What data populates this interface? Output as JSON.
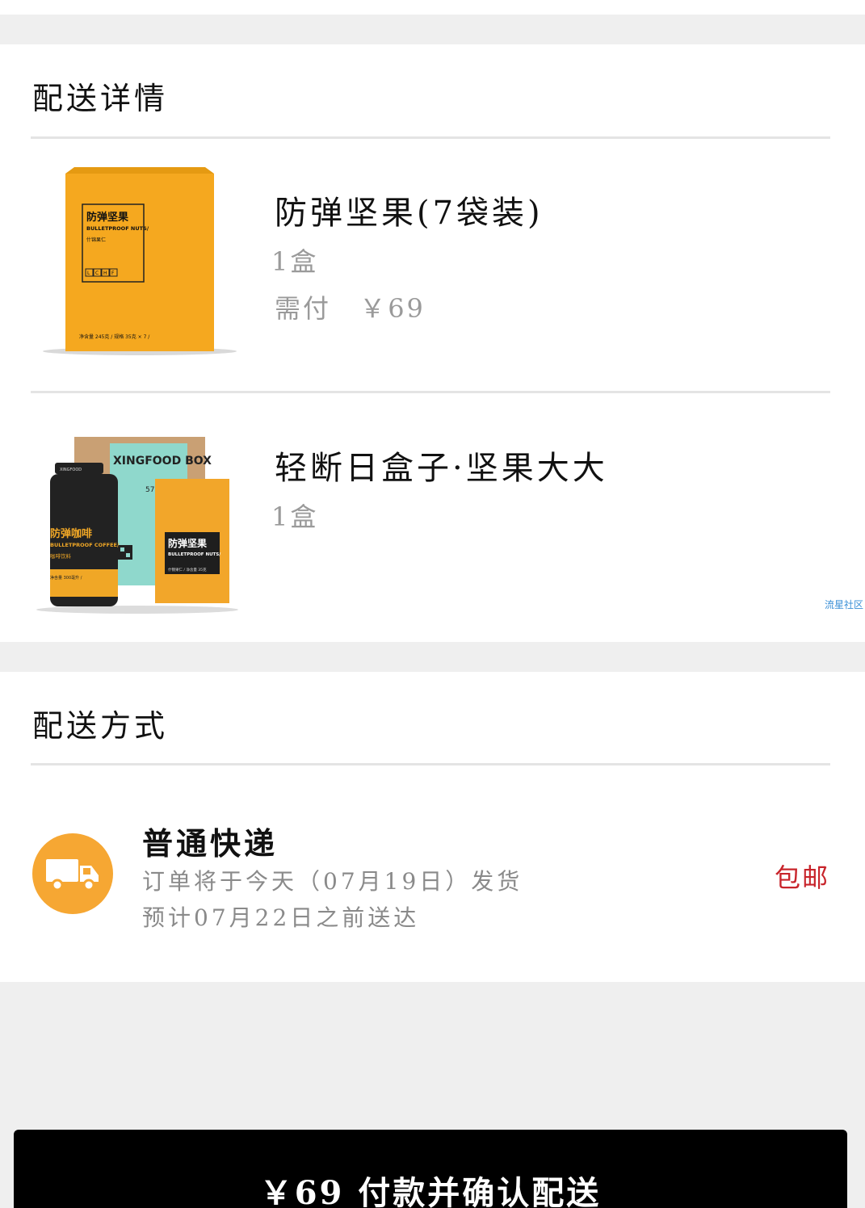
{
  "delivery_details": {
    "title": "配送详情",
    "items": [
      {
        "name": "防弹坚果(7袋装)",
        "quantity": "1盒",
        "price_label": "需付",
        "price": "￥69",
        "image_icon": "bulletproof-nuts-box",
        "image_text": {
          "brand": "防弹坚果",
          "english": "BULLETPROOF NUTS/",
          "sub": "什锦果仁",
          "tags": [
            "L",
            "C",
            "H",
            "F"
          ],
          "footer": "净含量 245克 /  规格 35克 × 7 /"
        }
      },
      {
        "name": "轻断日盒子·坚果大大",
        "quantity": "1盒",
        "image_icon": "xingfood-box-bundle",
        "image_text": {
          "box_title": "XINGFOOD BOX",
          "box_number": "575",
          "can_brand": "XINGFOOD",
          "can_name": "防弹咖啡",
          "can_english": "BULLETPROOF COFFEE/",
          "can_sub": "咖啡饮料",
          "can_volume": "净含量 300毫升 /",
          "bag_name": "防弹坚果",
          "bag_english": "BULLETPROOF NUTS/",
          "bag_sub": "什锦果仁 /  净含量 35克"
        }
      }
    ]
  },
  "watermark": "流星社区",
  "shipping": {
    "title": "配送方式",
    "icon": "truck-icon",
    "method": "普通快递",
    "ship_info": "订单将于今天（07月19日）发货",
    "eta": "预计07月22日之前送达",
    "badge": "包邮"
  },
  "pay_button": {
    "label": "￥69 付款并确认配送"
  },
  "colors": {
    "accent_orange": "#f6a733",
    "badge_red": "#c8242b",
    "button_bg": "#000000"
  }
}
